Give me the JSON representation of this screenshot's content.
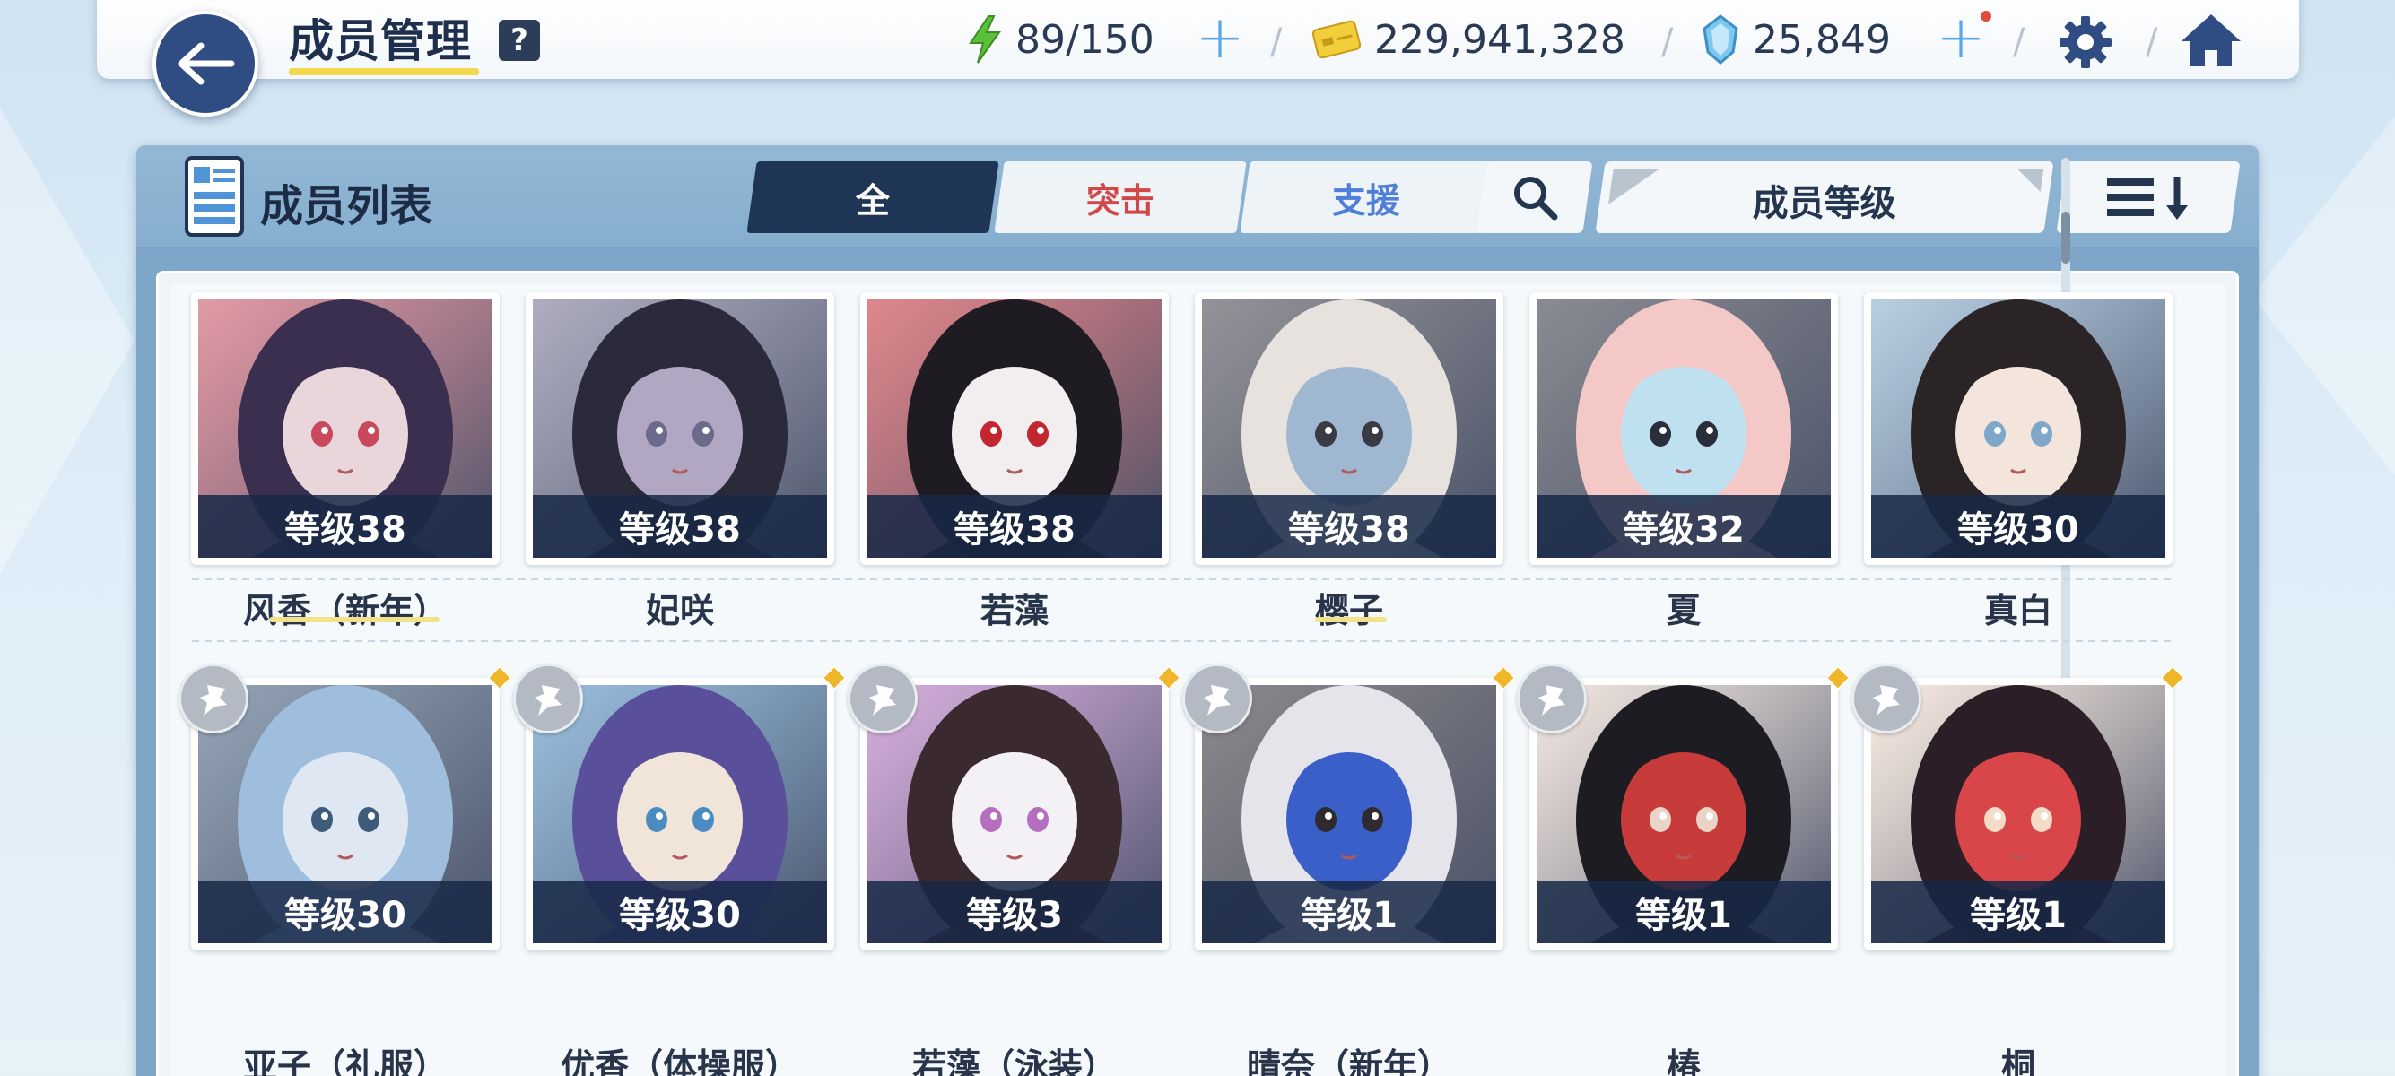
{
  "header": {
    "title": "成员管理",
    "help": "?",
    "stamina": "89/150",
    "credits": "229,941,328",
    "gems": "25,849"
  },
  "list": {
    "title": "成员列表",
    "tabs": [
      {
        "label": "全",
        "active": true
      },
      {
        "label": "突击",
        "active": false
      },
      {
        "label": "支援",
        "active": false
      }
    ],
    "sort_label": "成员等级"
  },
  "cards_row1": [
    {
      "level": "等级38",
      "name": "风香（新年）",
      "colors": [
        "#3a2f4e",
        "#e8d6da",
        "#c9485b"
      ]
    },
    {
      "level": "等级38",
      "name": "妃咲",
      "colors": [
        "#2b2a3a",
        "#b1a7c2",
        "#6b6a8a"
      ]
    },
    {
      "level": "等级38",
      "name": "若藻",
      "colors": [
        "#1e1b22",
        "#f2eef0",
        "#c2262e"
      ]
    },
    {
      "level": "等级38",
      "name": "樱子",
      "colors": [
        "#e7e2de",
        "#9fb7d0",
        "#3a3a44"
      ]
    },
    {
      "level": "等级32",
      "name": "夏",
      "colors": [
        "#f5c8c8",
        "#bfe0ef",
        "#2a2d3a"
      ]
    },
    {
      "level": "等级30",
      "name": "真白",
      "colors": [
        "#2a2426",
        "#f3e4dc",
        "#7fa7c9"
      ]
    }
  ],
  "cards_row2": [
    {
      "level": "等级30",
      "name": "亚子（礼服）",
      "colors": [
        "#9fbddc",
        "#dfe8f2",
        "#3e5b7a"
      ]
    },
    {
      "level": "等级30",
      "name": "优香（体操服）",
      "colors": [
        "#5a4f9a",
        "#f1e4d9",
        "#4a8cc2"
      ]
    },
    {
      "level": "等级3",
      "name": "若藻（泳装）",
      "colors": [
        "#3a2a30",
        "#f4f1f6",
        "#b46fbf"
      ]
    },
    {
      "level": "等级1",
      "name": "晴奈（新年）",
      "colors": [
        "#e5e4ea",
        "#3b5fc9",
        "#2e2a30"
      ]
    },
    {
      "level": "等级1",
      "name": "椿",
      "colors": [
        "#1c1c22",
        "#c83b3b",
        "#e9d5c8"
      ]
    },
    {
      "level": "等级1",
      "name": "桐",
      "colors": [
        "#2c1e26",
        "#d8464a",
        "#f4dcc9"
      ]
    }
  ],
  "colors": {
    "accent_dark": "#1f3556",
    "assault_red": "#d04848",
    "support_blue": "#4f7fd8",
    "level_bar": "#172846",
    "highlight": "#f2d94c"
  }
}
